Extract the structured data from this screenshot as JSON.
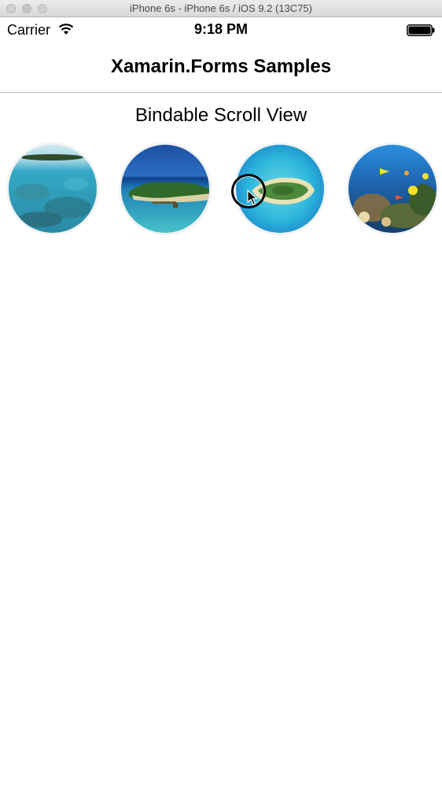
{
  "window": {
    "title": "iPhone 6s - iPhone 6s / iOS 9.2 (13C75)"
  },
  "status_bar": {
    "carrier": "Carrier",
    "time": "9:18 PM",
    "wifi_icon": "wifi-icon",
    "battery_icon": "battery-full-icon"
  },
  "nav": {
    "title": "Xamarin.Forms Samples"
  },
  "page": {
    "heading": "Bindable Scroll View",
    "images": [
      {
        "name": "lagoon-reef",
        "description_icon": "island-reef-photo"
      },
      {
        "name": "tropical-island",
        "description_icon": "island-photo"
      },
      {
        "name": "aerial-island",
        "description_icon": "aerial-island-photo"
      },
      {
        "name": "coral-fish",
        "description_icon": "coral-fish-photo"
      }
    ]
  },
  "colors": {
    "accent": "#000000",
    "water": "#2fb3d6",
    "deep_water": "#1d5fa8",
    "reef": "#4a7a3a"
  }
}
